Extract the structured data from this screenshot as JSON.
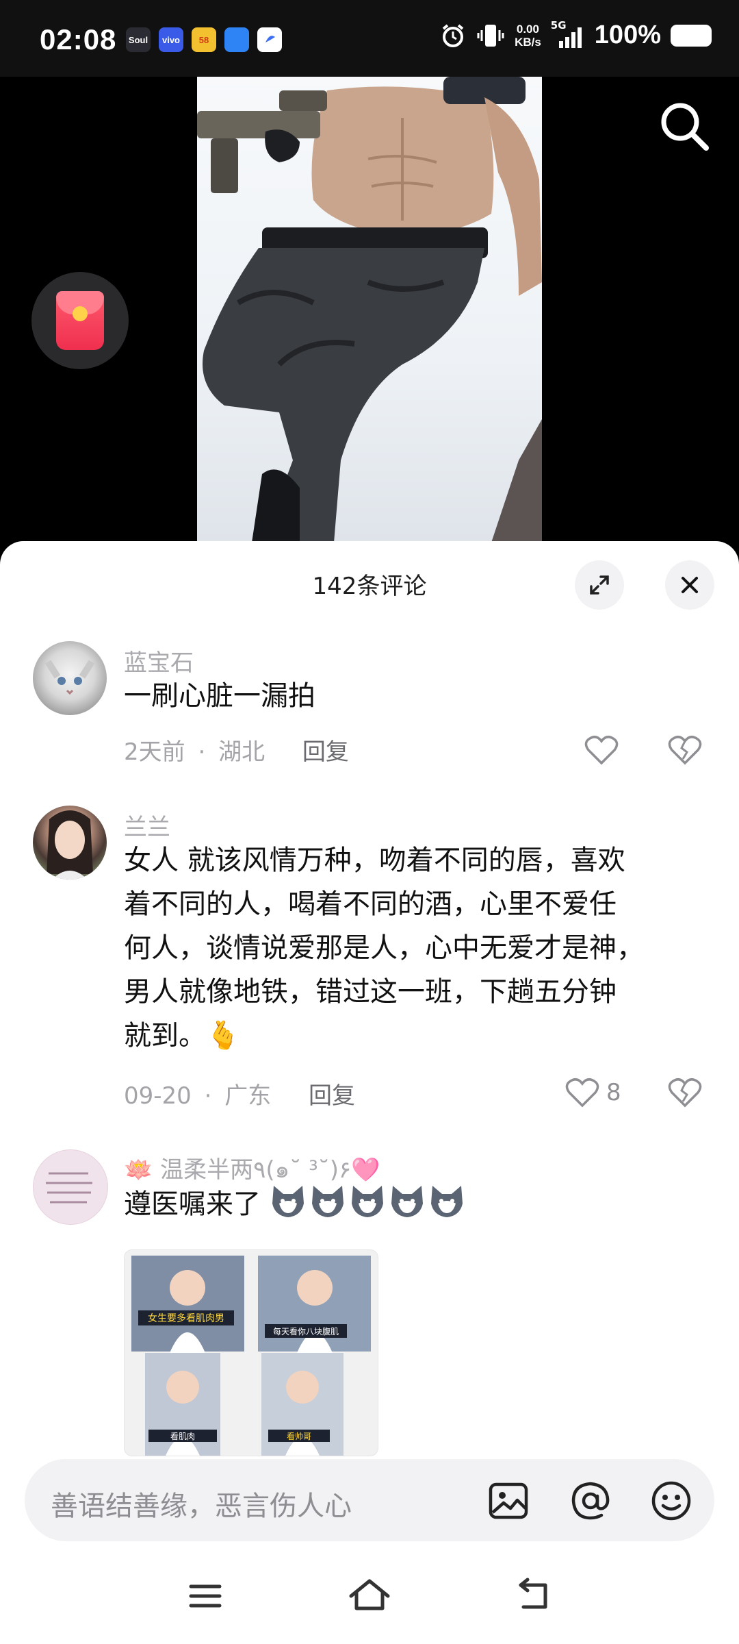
{
  "status_bar": {
    "time": "02:08",
    "app_icons": [
      {
        "label": "Soul",
        "color": "#2b2b33"
      },
      {
        "label": "vivo",
        "color": "#3a5ae8"
      },
      {
        "label": "58",
        "color": "#f3c12f"
      },
      {
        "label": "",
        "color": "#2f84f5"
      },
      {
        "label": "",
        "color": "#ffffff"
      }
    ],
    "net_speed_value": "0.00",
    "net_speed_unit": "KB/s",
    "network_type": "5G",
    "battery": "100%"
  },
  "comments_sheet": {
    "title": "142条评论",
    "input_placeholder": "善语结善缘，恶言伤人心"
  },
  "comments": [
    {
      "name": "蓝宝石",
      "text": "一刷心脏一漏拍",
      "time": "2天前",
      "separator": "·",
      "location": "湖北",
      "reply_label": "回复",
      "likes": ""
    },
    {
      "name": "兰兰",
      "text_lines": [
        "女人 就该风情万种，吻着不同的唇，喜欢",
        "着不同的人，喝着不同的酒，心里不爱任",
        "何人，谈情说爱那是人，心中无爱才是神，",
        "男人就像地铁，错过这一班，下趟五分钟",
        "就到。"
      ],
      "emoji": "🫰",
      "time": "09-20",
      "separator": "·",
      "location": "广东",
      "reply_label": "回复",
      "likes": "8"
    },
    {
      "name_prefix": "🪷",
      "name": "温柔半两٩(๑˘ ³˘)۶🩷",
      "text": "遵医嘱来了",
      "image_captions": [
        "女生要多看肌肉男",
        "每天看你八块腹肌",
        "看肌肉",
        "看帅哥"
      ]
    }
  ],
  "icons": {
    "search": "search-icon",
    "red_packet": "red-packet-icon",
    "expand": "expand-icon",
    "close": "close-icon",
    "heart": "heart-icon",
    "broken_heart": "broken-heart-icon",
    "image": "image-icon",
    "mention": "at-icon",
    "emoji": "emoji-icon",
    "menu": "menu-icon",
    "home": "home-icon",
    "back": "back-icon"
  },
  "colors": {
    "background": "#000000",
    "sheet": "#ffffff",
    "muted_text": "#a4a4a8",
    "red_packet": "#ef2f4e"
  }
}
